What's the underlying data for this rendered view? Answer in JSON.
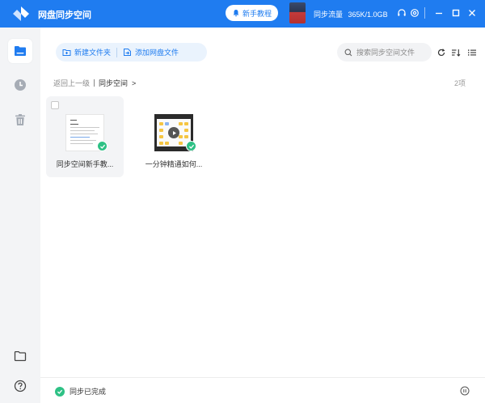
{
  "app": {
    "title": "网盘同步空间"
  },
  "header": {
    "tutorial_label": "新手教程",
    "traffic_label": "同步流量",
    "traffic_value": "365K/1.0GB"
  },
  "toolbar": {
    "new_folder_label": "新建文件夹",
    "add_file_label": "添加网盘文件",
    "search_placeholder": "搜索同步空间文件"
  },
  "breadcrumb": {
    "back_label": "返回上一级",
    "current_label": "同步空间",
    "arrow": ">"
  },
  "item_count": "2项",
  "files": [
    {
      "name": "同步空间新手教...",
      "type": "document",
      "synced": true
    },
    {
      "name": "一分钟精通如何...",
      "type": "video",
      "synced": true
    }
  ],
  "status": {
    "label": "同步已完成"
  },
  "colors": {
    "accent": "#1f7cf0",
    "success": "#2ec185",
    "sidebar_bg": "#f3f4f6"
  },
  "icons": [
    "sync-logo-icon",
    "bell-icon",
    "headset-icon",
    "settings-icon",
    "minimize-icon",
    "maximize-icon",
    "close-icon",
    "folder-icon",
    "clock-icon",
    "trash-icon",
    "folder-outline-icon",
    "help-icon",
    "refresh-icon",
    "sort-icon",
    "list-view-icon",
    "search-icon",
    "pause-icon",
    "check-icon"
  ]
}
